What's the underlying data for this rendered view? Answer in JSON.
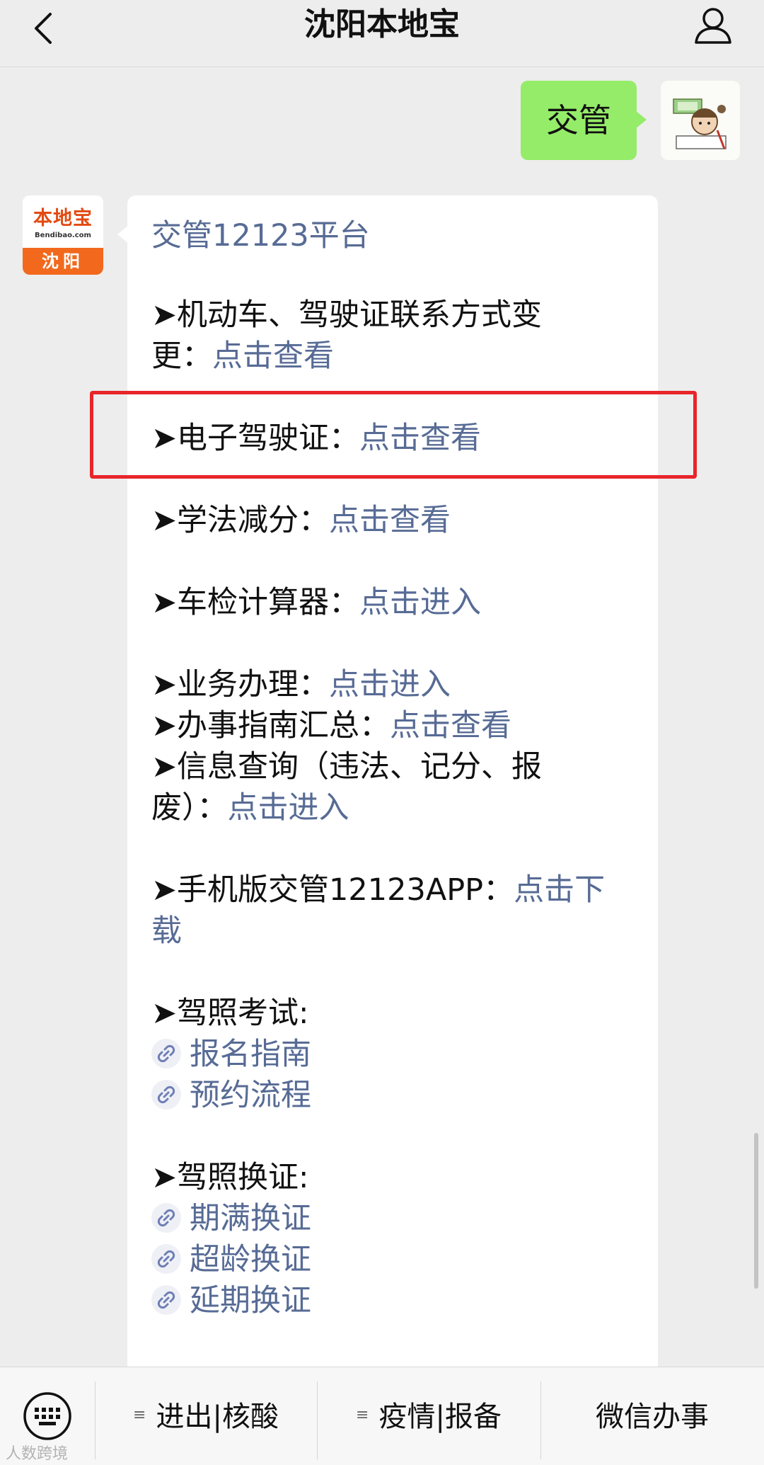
{
  "nav": {
    "title": "沈阳本地宝",
    "back_icon": "chevron-left-icon",
    "profile_icon": "person-icon"
  },
  "user_message": {
    "text": "交管"
  },
  "bot_avatar": {
    "logo_text": "本地宝",
    "logo_sub": "Bendibao.com",
    "city": "沈阳",
    "colors": {
      "orange": "#f2691e",
      "red": "#e24a12"
    }
  },
  "bot_message": {
    "title": "交管12123平台",
    "items": [
      {
        "prefix": "➤",
        "text_line1": "机动车、驾驶证联系方式变",
        "text_line2": "更：",
        "link": "点击查看"
      },
      {
        "prefix": "➤",
        "text": "电子驾驶证：",
        "link": "点击查看"
      },
      {
        "prefix": "➤",
        "text": "学法减分：",
        "link": "点击查看"
      },
      {
        "prefix": "➤",
        "text": "车检计算器：",
        "link": "点击进入"
      },
      {
        "prefix": "➤",
        "text": "业务办理：",
        "link": "点击进入"
      },
      {
        "prefix": "➤",
        "text": "办事指南汇总：",
        "link": "点击查看"
      },
      {
        "prefix": "➤",
        "text_line1": "信息查询（违法、记分、报",
        "text_line2": "废）：",
        "link": "点击进入"
      },
      {
        "prefix": "➤",
        "text": "手机版交管12123APP：",
        "link_part1": "点击下",
        "link_part2": "载"
      }
    ],
    "exam": {
      "heading": "➤驾照考试:",
      "links": [
        "报名指南",
        "预约流程"
      ]
    },
    "renewal": {
      "heading": "➤驾照换证:",
      "links": [
        "期满换证",
        "超龄换证",
        "延期换证"
      ]
    },
    "link_color": "#576b95",
    "highlight_color": "#e8252a"
  },
  "menu": {
    "keyboard_icon": "keyboard-icon",
    "items": [
      "进出|核酸",
      "疫情|报备",
      "微信办事"
    ]
  },
  "watermark": "人数跨境"
}
